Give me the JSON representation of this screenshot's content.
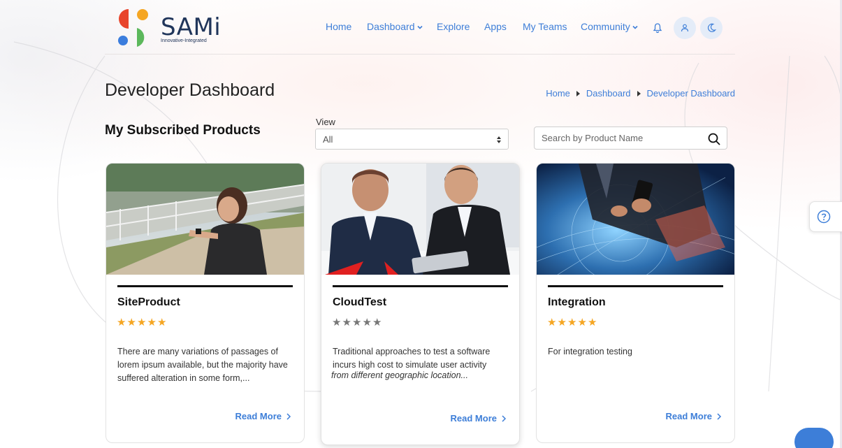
{
  "brand": {
    "name": "SAMi",
    "tagline": "Innovative-Integrated",
    "colors": {
      "red": "#e8452c",
      "orange": "#f5a623",
      "blue": "#3b7ddd",
      "green": "#5cb85c",
      "text": "#20355a"
    }
  },
  "nav": {
    "items": [
      {
        "label": "Home"
      },
      {
        "label": "Dashboard",
        "dropdown": true
      },
      {
        "label": "Explore"
      },
      {
        "label": "Apps"
      },
      {
        "label": "My Teams"
      },
      {
        "label": "Community",
        "dropdown": true
      }
    ],
    "icons": [
      "bell-icon",
      "user-icon",
      "moon-icon"
    ]
  },
  "page": {
    "title": "Developer Dashboard",
    "breadcrumb": [
      "Home",
      "Dashboard",
      "Developer Dashboard"
    ]
  },
  "section": {
    "title": "My Subscribed Products",
    "view_label": "View",
    "view_value": "All",
    "search_placeholder": "Search by Product Name"
  },
  "products": [
    {
      "name": "SiteProduct",
      "rating": 5,
      "description": "There are many variations of passages of lorem ipsum available, but the majority have suffered alteration in some form,...",
      "read_more": "Read More"
    },
    {
      "name": "CloudTest",
      "rating": 0,
      "description_line1": "Traditional approaches to test a software incurs high cost to simulate user activity",
      "description_line2": "from different geographic location...",
      "read_more": "Read More"
    },
    {
      "name": "Integration",
      "rating": 5,
      "description": "For integration testing",
      "read_more": "Read More"
    }
  ],
  "colors": {
    "accent": "#3d7ed8",
    "star_on": "#f5a623",
    "star_off": "#777777"
  }
}
